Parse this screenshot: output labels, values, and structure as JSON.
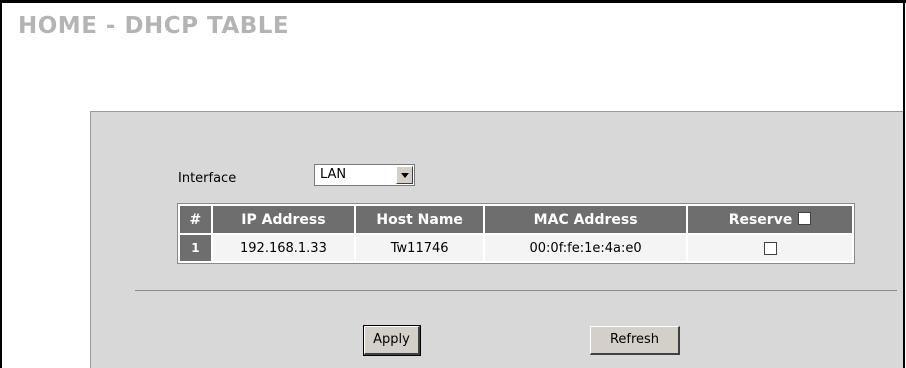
{
  "page": {
    "title": "HOME - DHCP TABLE"
  },
  "interface": {
    "label": "Interface",
    "selected": "LAN"
  },
  "table": {
    "headers": {
      "index": "#",
      "ip": "IP Address",
      "host": "Host Name",
      "mac": "MAC Address",
      "reserve": "Reserve"
    },
    "rows": [
      {
        "index": "1",
        "ip": "192.168.1.33",
        "host": "Tw11746",
        "mac": "00:0f:fe:1e:4a:e0",
        "reserve": false
      }
    ]
  },
  "buttons": {
    "apply": "Apply",
    "refresh": "Refresh"
  },
  "colors": {
    "title": "#b4b4b4",
    "panel": "#d8d8d8",
    "header_bg": "#6e6e6e"
  }
}
